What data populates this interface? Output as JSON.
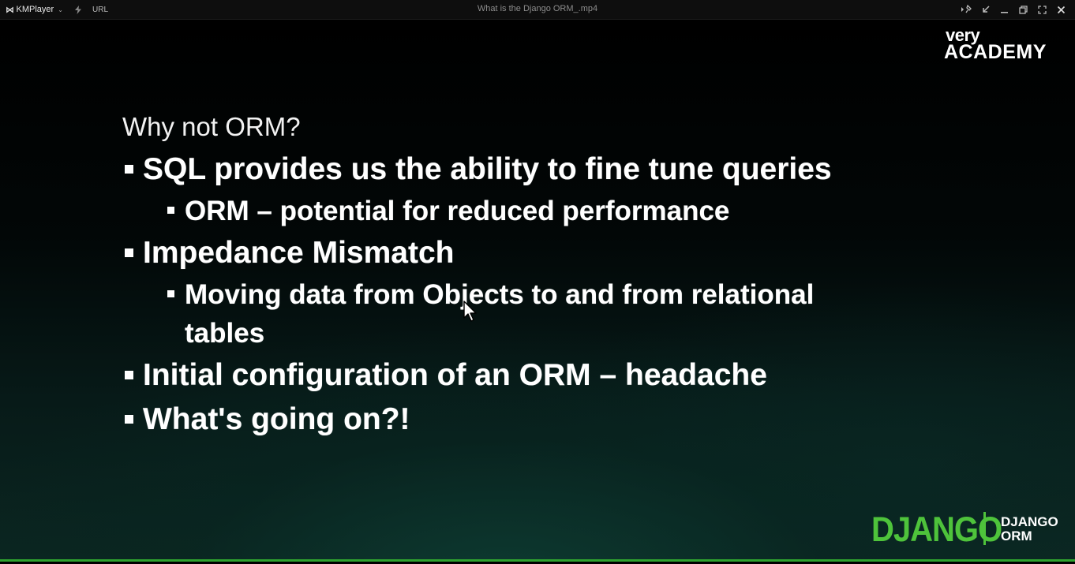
{
  "titlebar": {
    "logo": "⋈",
    "app_name": "KMPlayer",
    "caret": "⌄",
    "url_label": "URL",
    "file_title": "What is the Django ORM_.mp4"
  },
  "brand": {
    "line1": "very",
    "line2": "ACADEMY"
  },
  "slide": {
    "heading": "Why not ORM?",
    "bullets": [
      "SQL provides us the ability to fine tune queries",
      "ORM – potential for reduced performance",
      "Impedance Mismatch",
      "Moving data from Objects to and from relational",
      "tables",
      "Initial configuration of an ORM – headache",
      "What's going on?!"
    ]
  },
  "footer": {
    "django_logo": "DJANGO",
    "tag_line1": "DJANGO",
    "tag_line2": "ORM"
  },
  "colors": {
    "accent_green": "#4ec33b",
    "progress_green": "#2fa32f",
    "titlebar_bg": "#0e0e0e"
  },
  "icons": [
    "kmplayer-logo-icon",
    "lightning-icon",
    "pin-icon",
    "compact-mode-icon",
    "minimize-icon",
    "restore-icon",
    "fullscreen-icon",
    "close-icon",
    "mouse-cursor-icon"
  ]
}
